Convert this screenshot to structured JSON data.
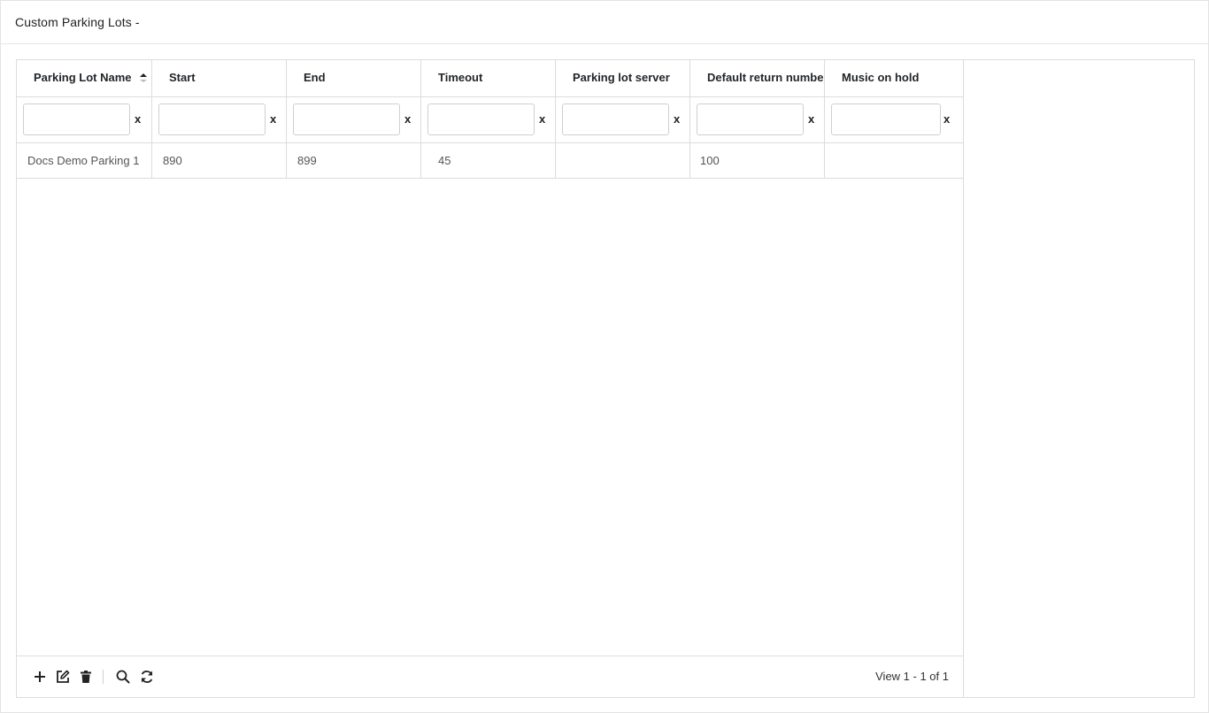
{
  "page": {
    "title": "Custom Parking Lots -"
  },
  "grid": {
    "columns": [
      {
        "label": "Parking Lot Name",
        "sorted": "asc"
      },
      {
        "label": "Start"
      },
      {
        "label": "End"
      },
      {
        "label": "Timeout"
      },
      {
        "label": "Parking lot server"
      },
      {
        "label": "Default return number"
      },
      {
        "label": "Music on hold"
      }
    ],
    "filters": [
      {
        "value": "",
        "clear_label": "x"
      },
      {
        "value": "",
        "clear_label": "x"
      },
      {
        "value": "",
        "clear_label": "x"
      },
      {
        "value": "",
        "clear_label": "x"
      },
      {
        "value": "",
        "clear_label": "x"
      },
      {
        "value": "",
        "clear_label": "x"
      },
      {
        "value": "",
        "clear_label": "x"
      }
    ],
    "rows": [
      [
        "Docs Demo Parking 1",
        "890",
        "899",
        "45",
        "",
        "100",
        ""
      ]
    ]
  },
  "footer": {
    "tools": [
      "plus-icon",
      "edit-icon",
      "trash-icon",
      "search-icon",
      "refresh-icon"
    ],
    "pager_text": "View 1 - 1 of 1"
  },
  "colors": {
    "border": "#dcdcdc",
    "text": "#212529",
    "cell_text": "#555555"
  }
}
